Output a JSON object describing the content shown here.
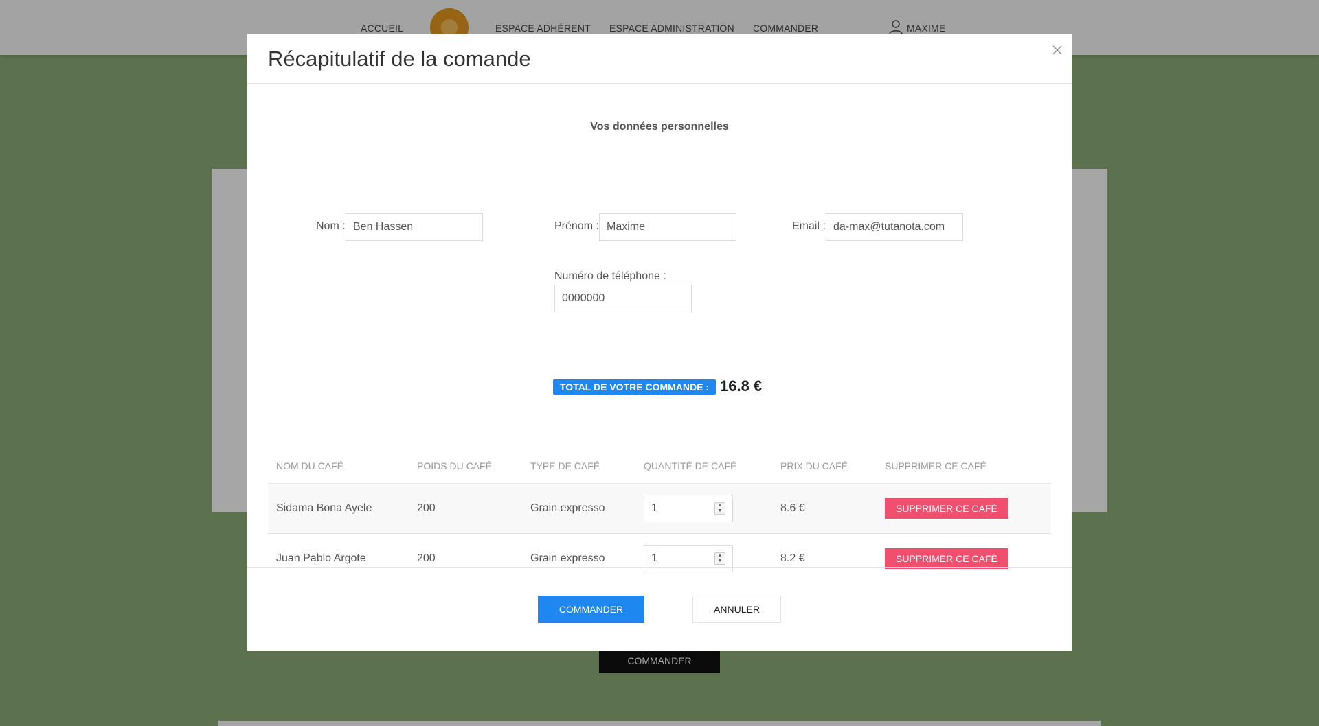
{
  "nav": {
    "items": [
      "ACCUEIL",
      "ESPACE ADHÉRENT",
      "ESPACE ADMINISTRATION",
      "COMMANDER"
    ],
    "user_label": "MAXIME",
    "logo_icon": "orange-logo",
    "user_icon": "user-icon"
  },
  "background": {
    "order_button_label": "COMMANDER"
  },
  "modal": {
    "title": "Récapitulatif de la comande",
    "close_icon": "close-icon",
    "personal_section_title": "Vos données personnelles",
    "fields": {
      "nom": {
        "label": "Nom :",
        "value": "Ben Hassen"
      },
      "prenom": {
        "label": "Prénom :",
        "value": "Maxime"
      },
      "email": {
        "label": "Email :",
        "value": "da-max@tutanota.com"
      },
      "telephone": {
        "label": "Numéro de téléphone :",
        "value": "0000000"
      }
    },
    "total": {
      "label": "TOTAL DE VOTRE COMMANDE :",
      "amount": "16.8 €"
    },
    "table": {
      "headers": [
        "NOM DU CAFÉ",
        "POIDS DU CAFÉ",
        "TYPE DE CAFÉ",
        "QUANTITÉ DE CAFÉ",
        "PRIX DU CAFÉ",
        "SUPPRIMER CE CAFÉ"
      ],
      "rows": [
        {
          "name": "Sidama Bona Ayele",
          "weight": "200",
          "type": "Grain expresso",
          "quantity": "1",
          "price": "8.6 €",
          "delete_label": "SUPPRIMER CE CAFÉ"
        },
        {
          "name": "Juan Pablo Argote",
          "weight": "200",
          "type": "Grain expresso",
          "quantity": "1",
          "price": "8.2 €",
          "delete_label": "SUPPRIMER CE CAFÉ"
        }
      ]
    },
    "footer": {
      "confirm_label": "COMMANDER",
      "cancel_label": "ANNULER"
    }
  },
  "colors": {
    "page_background": "#8eaf79",
    "primary": "#1e87f0",
    "danger": "#f0506e"
  }
}
